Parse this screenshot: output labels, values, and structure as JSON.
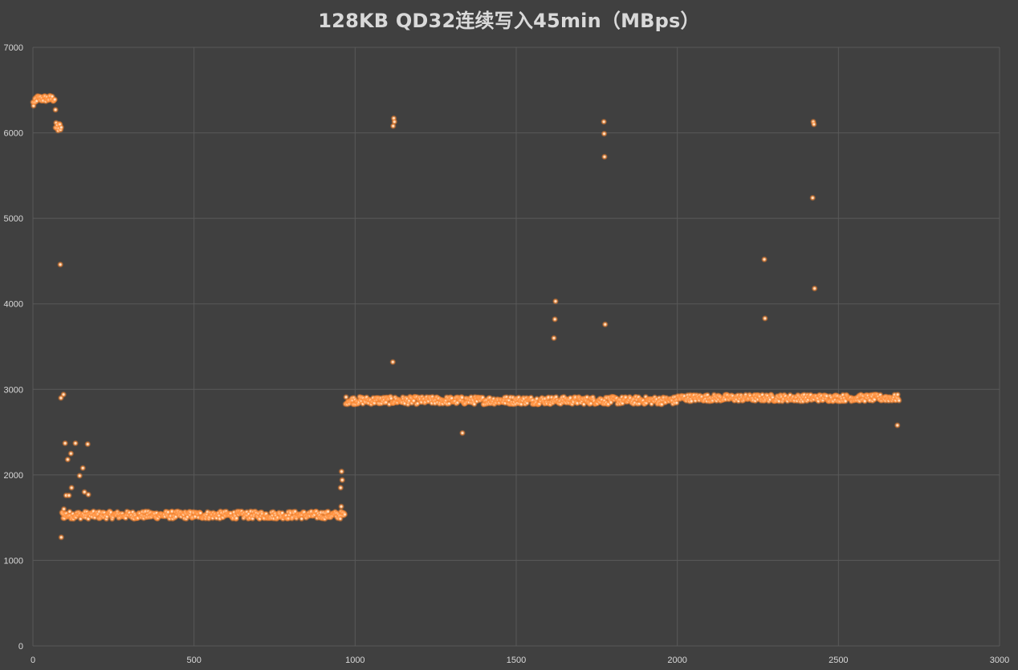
{
  "chart_data": {
    "type": "scatter",
    "title": "128KB QD32连续写入45min（MBps）",
    "xlabel": "",
    "ylabel": "",
    "xlim": [
      0,
      3000
    ],
    "ylim": [
      0,
      7000
    ],
    "x_ticks": [
      "0",
      "500",
      "1000",
      "1500",
      "2000",
      "2500",
      "3000"
    ],
    "y_ticks": [
      "0",
      "1000",
      "2000",
      "3000",
      "4000",
      "5000",
      "6000",
      "7000"
    ],
    "grid": true,
    "legend": "none",
    "marker_color": "#ff9a4d",
    "background_color": "#404040",
    "gridline_color": "#595959",
    "series": [
      {
        "bands": [
          {
            "x_start": 0,
            "x_end": 10,
            "y_center": 6340,
            "y_spread": 60
          },
          {
            "x_start": 10,
            "x_end": 70,
            "y_center": 6400,
            "y_spread": 40
          },
          {
            "x_start": 70,
            "x_end": 90,
            "y_center": 6060,
            "y_spread": 60
          },
          {
            "x_start": 90,
            "x_end": 970,
            "y_center": 1530,
            "y_spread": 45
          },
          {
            "x_start": 970,
            "x_end": 1500,
            "y_center": 2870,
            "y_spread": 45
          },
          {
            "x_start": 1500,
            "x_end": 2000,
            "y_center": 2870,
            "y_spread": 45
          },
          {
            "x_start": 2000,
            "x_end": 2690,
            "y_center": 2900,
            "y_spread": 40
          }
        ],
        "outliers": [
          [
            70,
            6270
          ],
          [
            85,
            4460
          ],
          [
            87,
            2900
          ],
          [
            95,
            2940
          ],
          [
            88,
            1270
          ],
          [
            100,
            2370
          ],
          [
            108,
            2180
          ],
          [
            118,
            2250
          ],
          [
            132,
            2370
          ],
          [
            145,
            1990
          ],
          [
            155,
            2080
          ],
          [
            160,
            1800
          ],
          [
            170,
            2360
          ],
          [
            172,
            1770
          ],
          [
            103,
            1760
          ],
          [
            112,
            1760
          ],
          [
            120,
            1850
          ],
          [
            96,
            1600
          ],
          [
            958,
            2040
          ],
          [
            960,
            1940
          ],
          [
            955,
            1850
          ],
          [
            957,
            1630
          ],
          [
            1117,
            3320
          ],
          [
            1120,
            6170
          ],
          [
            1122,
            6130
          ],
          [
            1118,
            6080
          ],
          [
            1333,
            2490
          ],
          [
            1617,
            3600
          ],
          [
            1620,
            3820
          ],
          [
            1622,
            4030
          ],
          [
            1772,
            6130
          ],
          [
            1773,
            5990
          ],
          [
            1774,
            5720
          ],
          [
            1776,
            3760
          ],
          [
            2270,
            4520
          ],
          [
            2272,
            3830
          ],
          [
            2422,
            6130
          ],
          [
            2424,
            6100
          ],
          [
            2420,
            5240
          ],
          [
            2426,
            4180
          ],
          [
            2683,
            2580
          ]
        ]
      }
    ]
  }
}
